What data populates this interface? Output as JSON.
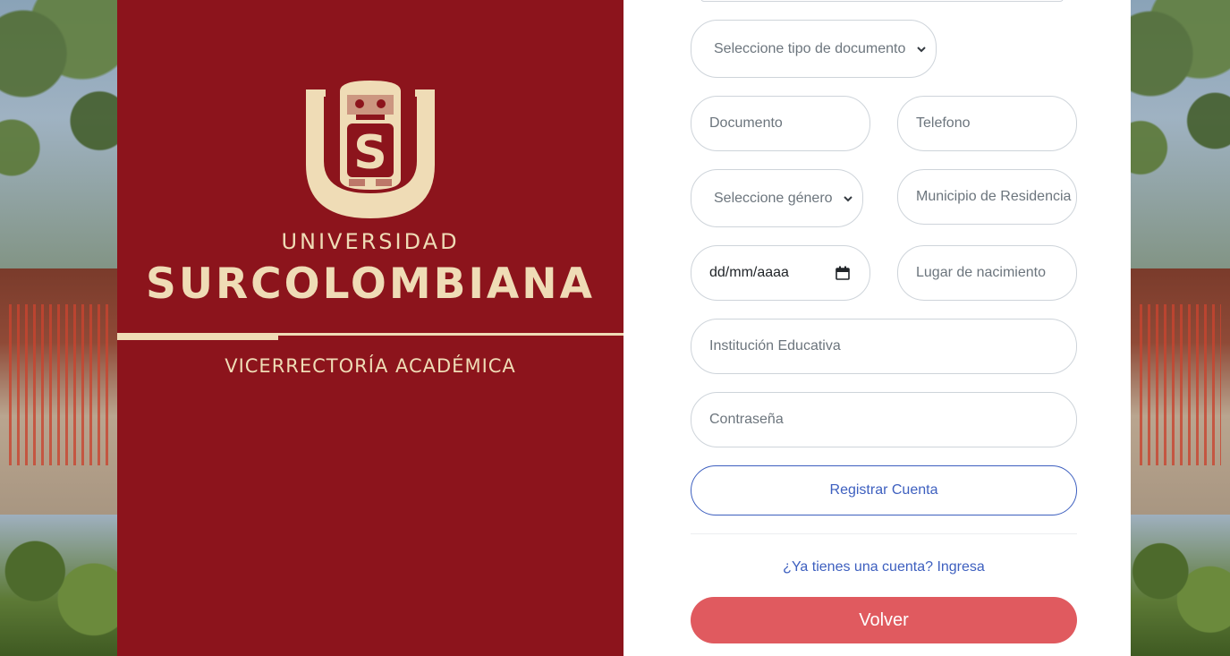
{
  "brand": {
    "university_small": "UNIVERSIDAD",
    "university_big": "SURCOLOMBIANA",
    "department": "VICERRECTORÍA ACADÉMICA",
    "color_primary": "#8c141c",
    "color_accent": "#efdcb6"
  },
  "form": {
    "document_type_select": "Seleccione tipo de documento",
    "document_placeholder": "Documento",
    "phone_placeholder": "Telefono",
    "gender_select": "Seleccione género",
    "municipality_placeholder": "Municipio de Residencia",
    "birth_date_value": "dd/mm/aaaa",
    "birthplace_placeholder": "Lugar de nacimiento",
    "institution_placeholder": "Institución Educativa",
    "password_placeholder": "Contraseña",
    "register_button": "Registrar Cuenta",
    "login_link": "¿Ya tienes una cuenta? Ingresa",
    "back_button": "Volver",
    "color_link": "#3d5fbf",
    "color_back": "#e05a5f"
  }
}
